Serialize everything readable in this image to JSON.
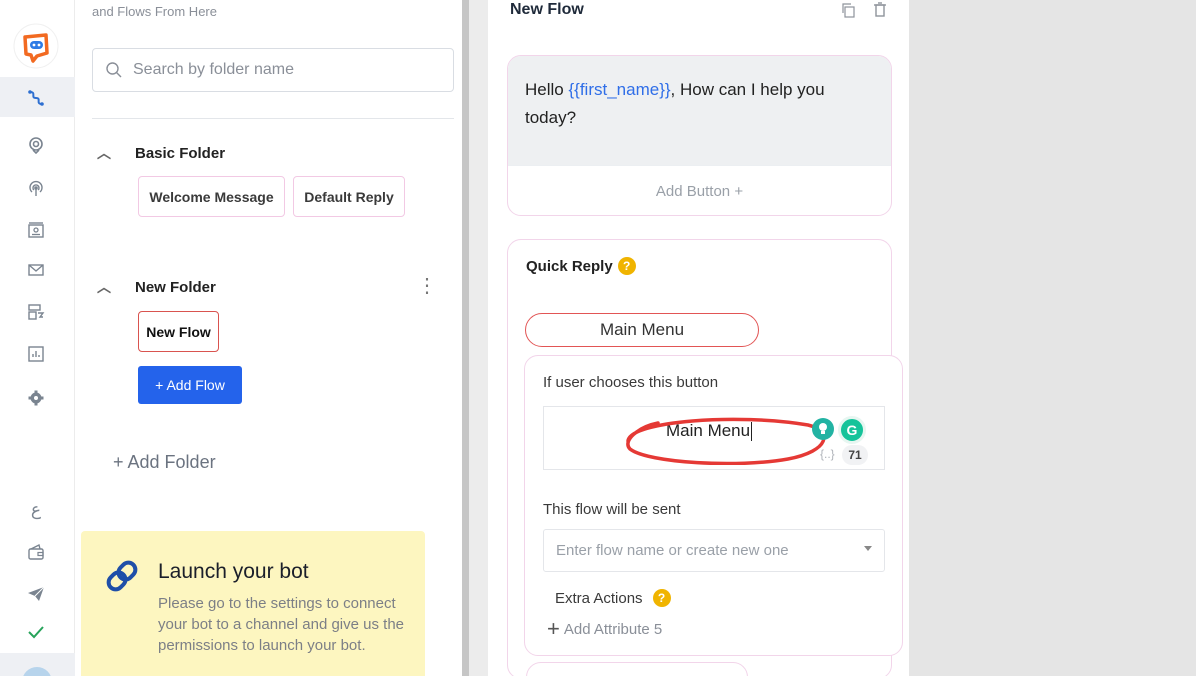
{
  "rail": {
    "icons": [
      "flows-icon",
      "bot-icon",
      "broadcast-icon",
      "contacts-icon",
      "mail-icon",
      "templates-icon",
      "analytics-icon",
      "settings-icon",
      "language-icon",
      "wallet-icon",
      "telegram-icon",
      "check-icon"
    ],
    "language_glyph": "ع"
  },
  "folders_panel": {
    "hint": "and Flows From Here",
    "search_placeholder": "Search by folder name",
    "folders": [
      {
        "name": "Basic Folder",
        "flows": [
          "Welcome Message",
          "Default Reply"
        ]
      },
      {
        "name": "New Folder",
        "flows": [
          "New Flow"
        ]
      }
    ],
    "add_flow_label": "+ Add Flow",
    "add_folder_label": "+ Add Folder",
    "launch": {
      "title": "Launch your bot",
      "body": "Please go to the settings to connect your bot to a channel and give us the permissions to launch your bot."
    }
  },
  "flow_panel": {
    "title": "New Flow",
    "message": {
      "prefix": "Hello ",
      "variable": "{{first_name}}",
      "suffix": ", How can I help you today?"
    },
    "add_button_label": "Add Button +",
    "quick_reply": {
      "title": "Quick Reply",
      "button_label": "Main Menu",
      "choose_label": "If user chooses this button",
      "input_value": "Main Menu",
      "brackets": "{..}",
      "char_count": "71",
      "flow_sent_label": "This flow will be sent",
      "flow_select_placeholder": "Enter flow name or create new one",
      "extra_actions_label": "Extra Actions",
      "add_attribute_label": "Add Attribute 5"
    }
  },
  "colors": {
    "accent_blue": "#2463eb",
    "brand_orange": "#f26a21",
    "annotation_red": "#e53935",
    "help_yellow": "#f0b400",
    "launch_bg": "#fdf6c0"
  }
}
